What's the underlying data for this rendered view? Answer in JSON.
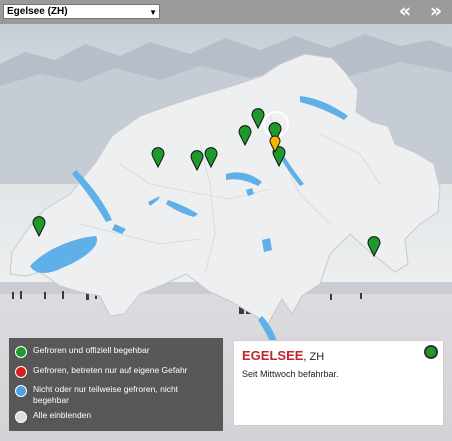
{
  "toolbar": {
    "selected_lake": "Egelsee (ZH)",
    "prev_symbol": "«",
    "next_symbol": "»"
  },
  "colors": {
    "green": "#1e9a2c",
    "red": "#d42020",
    "blue": "#4aa3df",
    "white": "#ffffff",
    "selected": "#f2b600",
    "title_red": "#c0272d"
  },
  "map": {
    "country": "Switzerland",
    "markers": [
      "green-pin",
      "green-pin",
      "green-pin",
      "green-pin",
      "green-pin",
      "green-pin",
      "green-pin",
      "green-pin",
      "green-pin",
      "green-pin",
      "selected-pin"
    ]
  },
  "legend": {
    "items": [
      {
        "label": "Gefroren und offiziell begehbar",
        "color": "#1e9a2c"
      },
      {
        "label": "Gefroren, betreten nur auf eigene Gefahr",
        "color": "#d42020"
      },
      {
        "label": "Nicht oder nur teilweise gefroren, nicht begehbar",
        "color": "#4aa3df"
      },
      {
        "label": "Alle einblenden",
        "color": "#dddddd"
      }
    ]
  },
  "info": {
    "name": "EGELSEE",
    "region": ", ZH",
    "status": "Seit Mittwoch befahrbar.",
    "status_color": "#1e9a2c"
  }
}
